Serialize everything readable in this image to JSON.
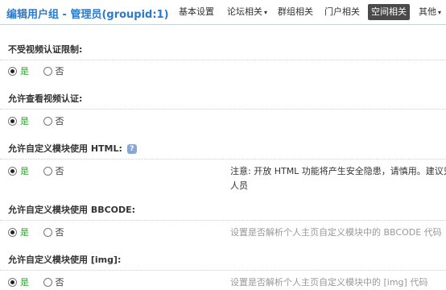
{
  "header": {
    "title": "编辑用户组 - 管理员(groupid:1)",
    "tabs": [
      {
        "label": "基本设置",
        "has_caret": false,
        "active": false
      },
      {
        "label": "论坛相关",
        "has_caret": true,
        "active": false
      },
      {
        "label": "群组相关",
        "has_caret": false,
        "active": false
      },
      {
        "label": "门户相关",
        "has_caret": false,
        "active": false
      },
      {
        "label": "空间相关",
        "has_caret": false,
        "active": true
      },
      {
        "label": "其他",
        "has_caret": true,
        "active": false
      }
    ],
    "caret": "▾"
  },
  "sections": [
    {
      "title": "不受视频认证限制:",
      "yes": "是",
      "no": "否",
      "selected": "yes",
      "description": ""
    },
    {
      "title": "允许查看视频认证:",
      "yes": "是",
      "no": "否",
      "selected": "yes",
      "description": ""
    },
    {
      "title": "允许自定义模块使用 HTML:",
      "help_icon": "help-icon",
      "help_glyph": "?",
      "yes": "是",
      "no": "否",
      "selected": "yes",
      "description_line1": "注意: 开放 HTML 功能将产生安全隐患，请慎用。建议只在",
      "description_line2": "人员"
    },
    {
      "title": "允许自定义模块使用 BBCODE:",
      "yes": "是",
      "no": "否",
      "selected": "yes",
      "description": "设置是否解析个人主页自定义模块中的 BBCODE 代码"
    },
    {
      "title": "允许自定义模块使用 [img]:",
      "yes": "是",
      "no": "否",
      "selected": "yes",
      "description": "设置是否解析个人主页自定义模块中的 [img] 代码"
    }
  ]
}
